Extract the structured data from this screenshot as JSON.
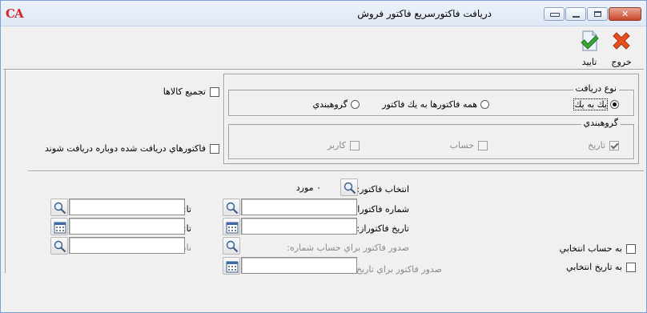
{
  "window": {
    "title": "دريافت فاکتورسريع فاکتور فروش",
    "logo_text": "CA",
    "logo_color": "#d8232a"
  },
  "toolbar": {
    "exit_label": "خروج",
    "confirm_label": "تاييد",
    "exit_icon": "close-x-icon",
    "confirm_icon": "document-check-icon"
  },
  "receive_type": {
    "legend": "نوع دريافت",
    "options": [
      {
        "label": "يك به يك",
        "selected": true
      },
      {
        "label": "همه فاكتورها به يك فاكتور",
        "selected": false
      },
      {
        "label": "گروهبندي",
        "selected": false
      }
    ]
  },
  "grouping": {
    "legend": "گروهبندي",
    "options": [
      {
        "label": "تاريخ",
        "checked": true
      },
      {
        "label": "حساب",
        "checked": false
      },
      {
        "label": "کاربر",
        "checked": false
      }
    ]
  },
  "left_options": {
    "merge_items": "تجميع كالاها",
    "re_receive": "فاكتورهاي دريافت شده دوباره دريافت شوند"
  },
  "selection": {
    "select_invoice_label": "انتخاب فاكتور:",
    "count_text": "٠ مورد",
    "invoice_number_from": "شماره فاكتوراز:",
    "invoice_date_from": "تاريخ فاكتوراز:",
    "to_label_1": "تا:",
    "to_label_2": "تا:",
    "issue_for_account": "صدور فاكتور براي حساب",
    "number_label": "شماره:",
    "name_label": "نام:",
    "issue_for_date": "صدور فاكتور براي تاريخ:",
    "for_selected_account": "به حساب انتخابي",
    "for_selected_date": "به تاريخ انتخابي"
  }
}
